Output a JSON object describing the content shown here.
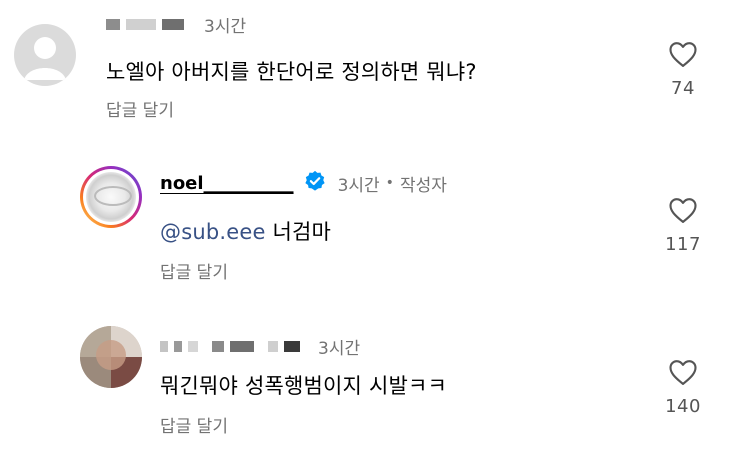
{
  "comments": [
    {
      "username_blurred": true,
      "time": "3시간",
      "text": "노엘아 아버지를 한단어로 정의하면 뭐냐?",
      "reply_label": "답글 달기",
      "likes": "74"
    },
    {
      "username": "noel__________",
      "verified": true,
      "time": "3시간",
      "separator": "•",
      "author_label": "작성자",
      "mention": "@sub.eee",
      "text": "너검마",
      "reply_label": "답글 달기",
      "likes": "117"
    },
    {
      "username_blurred": true,
      "time": "3시간",
      "text": "뭐긴뭐야 성폭행범이지 시발ㅋㅋ",
      "reply_label": "답글 달기",
      "likes": "140"
    }
  ],
  "colors": {
    "verified_badge": "#0095f6",
    "mention": "#385185",
    "secondary_text": "#737373"
  },
  "icons": [
    "default-avatar-icon",
    "heart-icon",
    "verified-badge-icon"
  ]
}
